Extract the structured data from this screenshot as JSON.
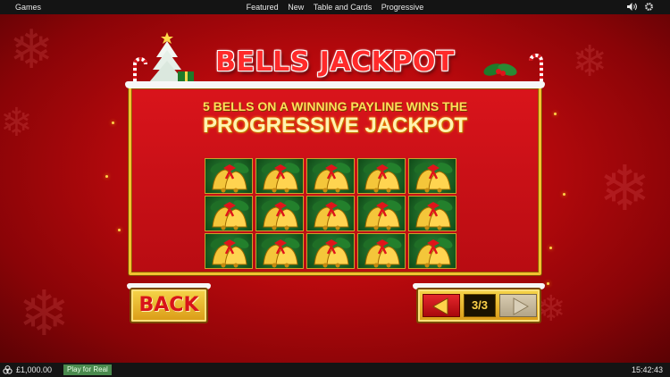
{
  "topbar": {
    "games_label": "Games",
    "nav": [
      "Featured",
      "New",
      "Table and Cards",
      "Progressive"
    ],
    "icons": [
      "speaker-icon",
      "gear-icon"
    ]
  },
  "game": {
    "title": "BELLS JACKPOT",
    "line1": "5 BELLS ON A WINNING PAYLINE WINS THE",
    "line2": "PROGRESSIVE JACKPOT",
    "grid_symbol": "bell-icon",
    "grid_rows": 3,
    "grid_cols": 5,
    "back_label": "BACK",
    "page_indicator": "3/3"
  },
  "bottombar": {
    "balance": "£1,000.00",
    "play_label": "Play for Real",
    "clock": "15:42:43"
  },
  "colors": {
    "background": "#c00a0e",
    "gold": "#f2c230",
    "title": "#ff2a2a"
  }
}
